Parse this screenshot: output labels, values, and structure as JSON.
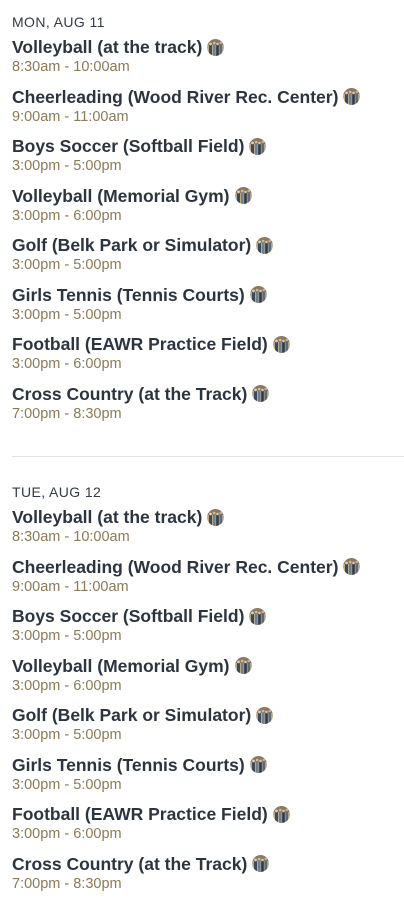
{
  "days": [
    {
      "header": "MON, AUG 11",
      "events": [
        {
          "title": "Volleyball (at the track)",
          "time": "8:30am - 10:00am"
        },
        {
          "title": "Cheerleading (Wood River Rec. Center)",
          "time": "9:00am - 11:00am"
        },
        {
          "title": "Boys Soccer (Softball Field)",
          "time": "3:00pm - 5:00pm"
        },
        {
          "title": "Volleyball (Memorial Gym)",
          "time": "3:00pm - 6:00pm"
        },
        {
          "title": "Golf (Belk Park or Simulator)",
          "time": "3:00pm - 5:00pm"
        },
        {
          "title": "Girls Tennis (Tennis Courts)",
          "time": "3:00pm - 5:00pm"
        },
        {
          "title": "Football (EAWR Practice Field)",
          "time": "3:00pm - 6:00pm"
        },
        {
          "title": "Cross Country (at the Track)",
          "time": "7:00pm - 8:30pm"
        }
      ]
    },
    {
      "header": "TUE, AUG 12",
      "events": [
        {
          "title": "Volleyball (at the track)",
          "time": "8:30am - 10:00am"
        },
        {
          "title": "Cheerleading (Wood River Rec. Center)",
          "time": "9:00am - 11:00am"
        },
        {
          "title": "Boys Soccer (Softball Field)",
          "time": "3:00pm - 5:00pm"
        },
        {
          "title": "Volleyball (Memorial Gym)",
          "time": "3:00pm - 6:00pm"
        },
        {
          "title": "Golf (Belk Park or Simulator)",
          "time": "3:00pm - 5:00pm"
        },
        {
          "title": "Girls Tennis (Tennis Courts)",
          "time": "3:00pm - 5:00pm"
        },
        {
          "title": "Football (EAWR Practice Field)",
          "time": "3:00pm - 6:00pm"
        },
        {
          "title": "Cross Country (at the Track)",
          "time": "7:00pm - 8:30pm"
        }
      ]
    }
  ],
  "icons": {
    "avatar": "avatar-icon"
  },
  "colors": {
    "title": "#2c3440",
    "time": "#8c7a55",
    "header": "#333a45",
    "divider": "#e4e2dc"
  }
}
